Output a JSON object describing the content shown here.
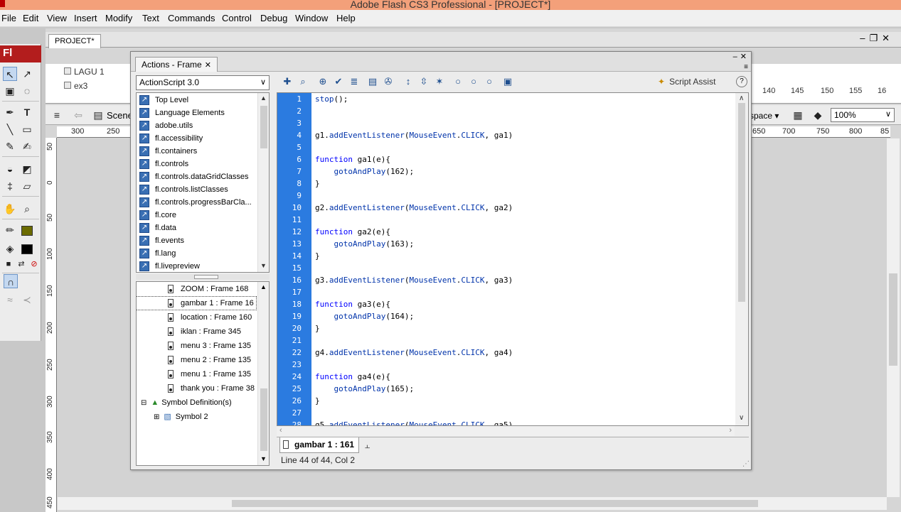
{
  "window": {
    "title": "Adobe Flash CS3 Professional - [PROJECT*]"
  },
  "menubar": {
    "items": [
      "File",
      "Edit",
      "View",
      "Insert",
      "Modify",
      "Text",
      "Commands",
      "Control",
      "Debug",
      "Window",
      "Help"
    ]
  },
  "tools": {
    "logo": "Fl"
  },
  "document": {
    "tab": "PROJECT*",
    "layers": [
      "LAGU 1",
      "ex3"
    ],
    "frame_numbers": [
      "140",
      "145",
      "150",
      "155",
      "16"
    ],
    "scene_label": "Scene",
    "workspace_label": "space",
    "zoom": "100%",
    "ruler_h": [
      "300",
      "250",
      "650",
      "700",
      "750",
      "800",
      "85"
    ],
    "ruler_v": [
      "50",
      "0",
      "50",
      "100",
      "150",
      "200",
      "250",
      "300",
      "350",
      "400",
      "450"
    ]
  },
  "actions_panel": {
    "tab": "Actions - Frame",
    "language_select": "ActionScript 3.0",
    "toolbox": [
      "Top Level",
      "Language Elements",
      "adobe.utils",
      "fl.accessibility",
      "fl.containers",
      "fl.controls",
      "fl.controls.dataGridClasses",
      "fl.controls.listClasses",
      "fl.controls.progressBarCla...",
      "fl.core",
      "fl.data",
      "fl.events",
      "fl.lang",
      "fl.livepreview"
    ],
    "navigator": [
      "ZOOM : Frame 168",
      "gambar 1 : Frame 16",
      "location : Frame 160",
      "iklan : Frame 345",
      "menu 3 : Frame 135",
      "menu 2 : Frame 135",
      "menu 1 : Frame 135",
      "thank you : Frame 38"
    ],
    "symbol_definitions": "Symbol Definition(s)",
    "symbol_item": "Symbol 2",
    "script_assist": "Script Assist",
    "help": "?",
    "code_lines": [
      {
        "n": "1",
        "text": "stop();"
      },
      {
        "n": "2",
        "text": ""
      },
      {
        "n": "3",
        "text": ""
      },
      {
        "n": "4",
        "text": "g1.addEventListener(MouseEvent.CLICK, ga1)"
      },
      {
        "n": "5",
        "text": ""
      },
      {
        "n": "6",
        "text": "function ga1(e){"
      },
      {
        "n": "7",
        "text": "    gotoAndPlay(162);"
      },
      {
        "n": "8",
        "text": "}"
      },
      {
        "n": "9",
        "text": ""
      },
      {
        "n": "10",
        "text": "g2.addEventListener(MouseEvent.CLICK, ga2)"
      },
      {
        "n": "11",
        "text": ""
      },
      {
        "n": "12",
        "text": "function ga2(e){"
      },
      {
        "n": "13",
        "text": "    gotoAndPlay(163);"
      },
      {
        "n": "14",
        "text": "}"
      },
      {
        "n": "15",
        "text": ""
      },
      {
        "n": "16",
        "text": "g3.addEventListener(MouseEvent.CLICK, ga3)"
      },
      {
        "n": "17",
        "text": ""
      },
      {
        "n": "18",
        "text": "function ga3(e){"
      },
      {
        "n": "19",
        "text": "    gotoAndPlay(164);"
      },
      {
        "n": "20",
        "text": "}"
      },
      {
        "n": "21",
        "text": ""
      },
      {
        "n": "22",
        "text": "g4.addEventListener(MouseEvent.CLICK, ga4)"
      },
      {
        "n": "23",
        "text": ""
      },
      {
        "n": "24",
        "text": "function ga4(e){"
      },
      {
        "n": "25",
        "text": "    gotoAndPlay(165);"
      },
      {
        "n": "26",
        "text": "}"
      },
      {
        "n": "27",
        "text": ""
      },
      {
        "n": "28",
        "text": "g5.addEventListener(MouseEvent.CLICK, ga5)"
      }
    ],
    "script_tab": "gambar 1 : 161",
    "status": "Line 44 of 44, Col 2"
  },
  "colors": {
    "titlebar": "#f3a07a",
    "gutter": "#2b7be0",
    "flash_logo": "#b31d1d",
    "keyword": "#0000ff"
  }
}
